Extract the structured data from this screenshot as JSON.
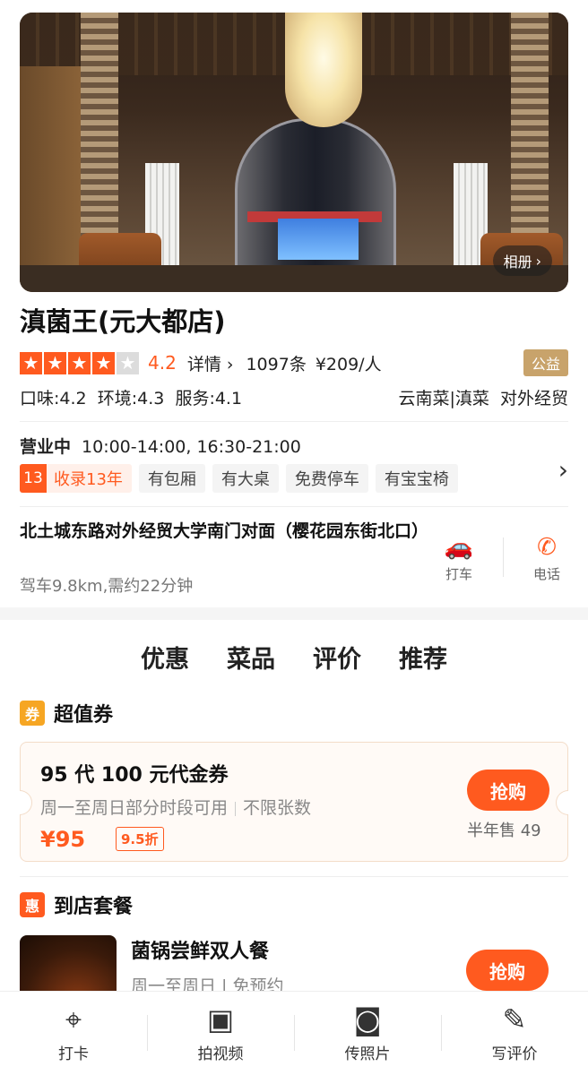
{
  "hero": {
    "album_label": "相册"
  },
  "store": {
    "name": "滇菌王(元大都店)",
    "score": "4.2",
    "stars": 4,
    "details_link": "详情",
    "review_count": "1097条",
    "price_per_person": "¥209/人",
    "charity_badge": "公益",
    "taste": "口味:4.2",
    "environment": "环境:4.3",
    "service": "服务:4.1",
    "cuisine": "云南菜|滇菜",
    "area": "对外经贸",
    "hours_status": "营业中",
    "hours": "10:00-14:00, 16:30-21:00",
    "tags": {
      "years_num": "13",
      "years": "收录13年",
      "t1": "有包厢",
      "t2": "有大桌",
      "t3": "免费停车",
      "t4": "有宝宝椅"
    },
    "address": "北土城东路对外经贸大学南门对面（樱花园东街北口）",
    "distance": "驾车9.8km,需约22分钟",
    "taxi_label": "打车",
    "call_label": "电话"
  },
  "tabs": {
    "t0": "优惠",
    "t1": "菜品",
    "t2": "评价",
    "t3": "推荐"
  },
  "voucher_section": {
    "badge": "券",
    "title": "超值券",
    "name": "95 代 100 元代金券",
    "usage": "周一至周日部分时段可用",
    "limit": "不限张数",
    "price": "¥95",
    "discount": "9.5折",
    "grab_label": "抢购",
    "sold": "半年售 49"
  },
  "package_section": {
    "badge": "惠",
    "title": "到店套餐",
    "name": "菌锅尝鲜双人餐",
    "usage": "周一至周日 | 免预约",
    "grab_label": "抢购"
  },
  "bottom_bar": {
    "checkin": "打卡",
    "video": "拍视频",
    "photo": "传照片",
    "review": "写评价"
  }
}
